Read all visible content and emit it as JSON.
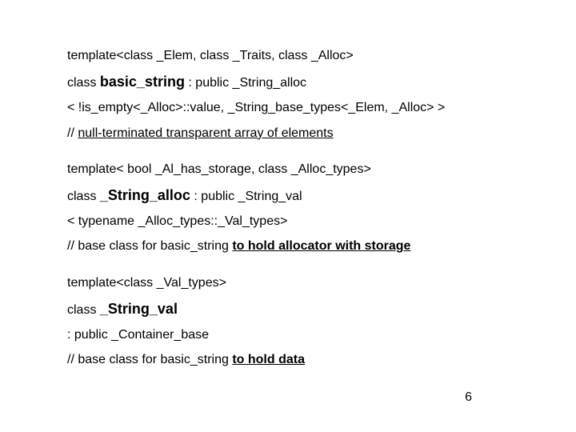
{
  "block1": {
    "l1_a": "template",
    "l1_b": "<class _Elem,  class _Traits, class _Alloc>",
    "l2_a": "class ",
    "l2_b": "basic_string",
    "l2_c": " : public _String_alloc",
    "l3": "< !is_empty<_Alloc>::value,  _String_base_types<_Elem, _Alloc> >",
    "l4_a": "// ",
    "l4_b": "null-terminated transparent array of elements"
  },
  "block2": {
    "l1_a": "template",
    "l1_b": "< bool _Al_has_storage, class  _Alloc_types>",
    "l2_a": "class ",
    "l2_b": "_String_alloc",
    "l2_c": " : public _String_val",
    "l3": " < typename  _Alloc_types::_Val_types>",
    "l4_a": "// base class for basic_string ",
    "l4_b": " to hold allocator with storage"
  },
  "block3": {
    "l1_a": "template",
    "l1_b": "<class _Val_types>",
    "l2_a": "class ",
    "l2_b": "_String_val",
    "l3": ": public _Container_base",
    "l4_a": " // base class for basic_string ",
    "l4_b": "to hold data"
  },
  "page": "6"
}
